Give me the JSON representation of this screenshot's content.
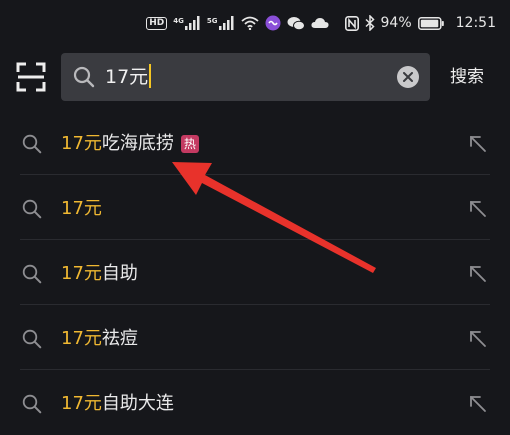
{
  "status_bar": {
    "hd_badge": "HD",
    "net_label_1": "4G",
    "net_label_2": "5G",
    "battery": "94%",
    "time": "12:51",
    "icons": [
      "hd-icon",
      "signal-icon",
      "signal-icon",
      "wifi-icon",
      "app-icon",
      "wechat-icon",
      "cloud-icon",
      "nfc-icon",
      "bluetooth-icon",
      "battery-icon"
    ]
  },
  "search": {
    "value": "17元",
    "submit_label": "搜索",
    "icons": [
      "scan-icon",
      "search-icon",
      "clear-icon"
    ]
  },
  "suggestions": [
    {
      "highlight": "17元",
      "rest": "吃海底捞",
      "badge": "热"
    },
    {
      "highlight": "17元",
      "rest": ""
    },
    {
      "highlight": "17元",
      "rest": "自助"
    },
    {
      "highlight": "17元",
      "rest": "祛痘"
    },
    {
      "highlight": "17元",
      "rest": "自助大连"
    }
  ],
  "colors": {
    "background": "#16171b",
    "highlight": "#f0b832",
    "caret": "#f5c623",
    "hot_badge": "#c43a62",
    "annotation_arrow": "#e8322b"
  }
}
